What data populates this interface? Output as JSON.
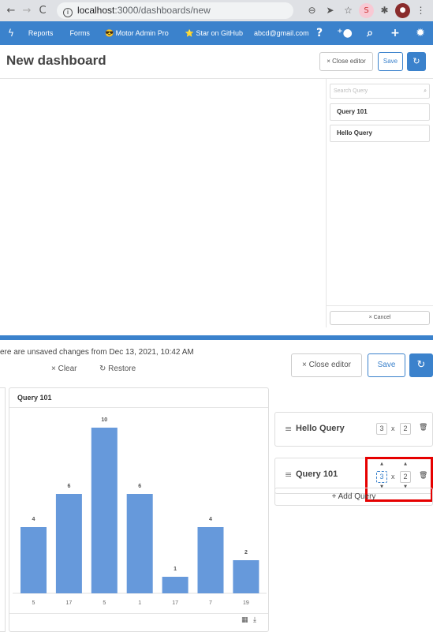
{
  "browser": {
    "url_host": "localhost",
    "url_path": ":3000/dashboards/new"
  },
  "navbar": {
    "items": [
      "Reports",
      "Forms",
      "Motor Admin Pro",
      "Star on GitHub",
      "abcd@gmail.com"
    ],
    "pro_emoji": "😎",
    "star_emoji": "⭐"
  },
  "header": {
    "title": "New dashboard",
    "close_editor": "× Close editor",
    "save": "Save"
  },
  "sidebar": {
    "search_placeholder": "Search Query",
    "queries": [
      "Query 101",
      "Hello Query"
    ],
    "cancel": "× Cancel"
  },
  "lower": {
    "unsaved_text": "ere are unsaved changes from Dec 13, 2021, 10:42 AM",
    "clear": "× Clear",
    "restore": "Restore",
    "close_editor": "× Close editor",
    "save": "Save",
    "chart_title": "Query 101",
    "cards": [
      {
        "name": "Hello Query",
        "w": "3",
        "h": "2"
      },
      {
        "name": "Query 101",
        "w": "3",
        "h": "2"
      }
    ],
    "x_sep": "x",
    "add_query": "+ Add Query"
  },
  "chart_data": {
    "type": "bar",
    "categories": [
      "5",
      "17",
      "5",
      "1",
      "17",
      "7",
      "19"
    ],
    "values": [
      4,
      6,
      10,
      6,
      1,
      4,
      2
    ],
    "ylim": [
      0,
      10
    ],
    "color": "#6699db",
    "grid": false
  }
}
